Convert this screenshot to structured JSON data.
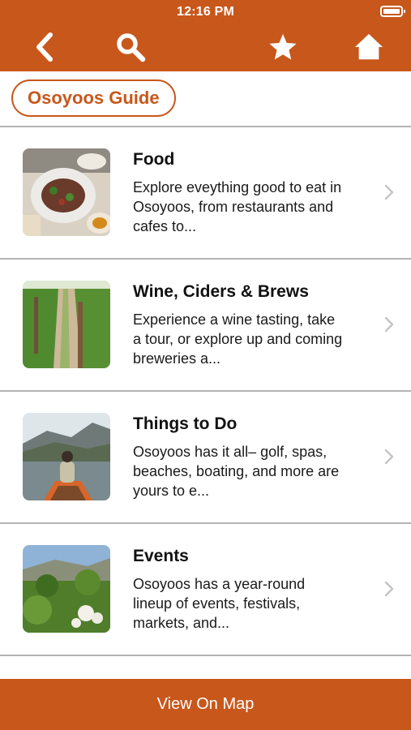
{
  "status_bar": {
    "time": "12:16 PM"
  },
  "nav": {
    "back_icon": "chevron-left-icon",
    "search_icon": "search-icon",
    "favorites_icon": "star-icon",
    "home_icon": "home-icon"
  },
  "guide_button": {
    "label": "Osoyoos Guide"
  },
  "categories": [
    {
      "title": "Food",
      "description": "Explore eveything good to eat in Osoyoos, from restaurants and cafes to..."
    },
    {
      "title": "Wine, Ciders & Brews",
      "description": "Experience a wine tasting, take a tour, or explore up and coming breweries a..."
    },
    {
      "title": "Things to Do",
      "description": "Osoyoos has it all– golf, spas, beaches, boating, and more are yours to e..."
    },
    {
      "title": "Events",
      "description": "Osoyoos has a year-round lineup of events, festivals, markets, and..."
    }
  ],
  "bottom_bar": {
    "label": "View On Map"
  },
  "colors": {
    "accent": "#c8571b",
    "divider": "#b3b3b3",
    "chevron": "#c4c4c4"
  }
}
